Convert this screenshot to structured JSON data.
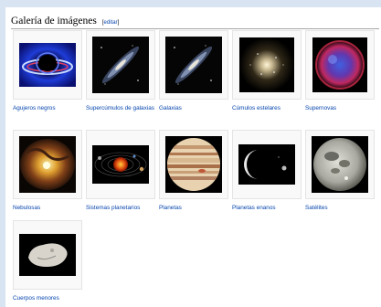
{
  "section": {
    "title": "Galería de imágenes",
    "edit_open": "[",
    "edit_label": "editar",
    "edit_close": "]"
  },
  "gallery": {
    "items": [
      {
        "caption": "Agujeros negros",
        "image": "black-hole"
      },
      {
        "caption": "Supercúmulos de galaxias",
        "image": "galaxy-supercluster"
      },
      {
        "caption": "Galaxias",
        "image": "galaxy"
      },
      {
        "caption": "Cúmulos estelares",
        "image": "star-cluster"
      },
      {
        "caption": "Supernovas",
        "image": "supernova"
      },
      {
        "caption": "Nebulosas",
        "image": "nebula"
      },
      {
        "caption": "Sistemas planetarios",
        "image": "planetary-system"
      },
      {
        "caption": "Planetas",
        "image": "planet-jupiter"
      },
      {
        "caption": "Planetas enanos",
        "image": "dwarf-planet"
      },
      {
        "caption": "Satélites",
        "image": "moon"
      },
      {
        "caption": "Cuerpos menores",
        "image": "asteroid"
      }
    ]
  },
  "colors": {
    "link": "#0645ad",
    "page_background": "#ffffff",
    "frame_background": "#d9e4f2",
    "thumb_border": "#e4e4e4"
  }
}
